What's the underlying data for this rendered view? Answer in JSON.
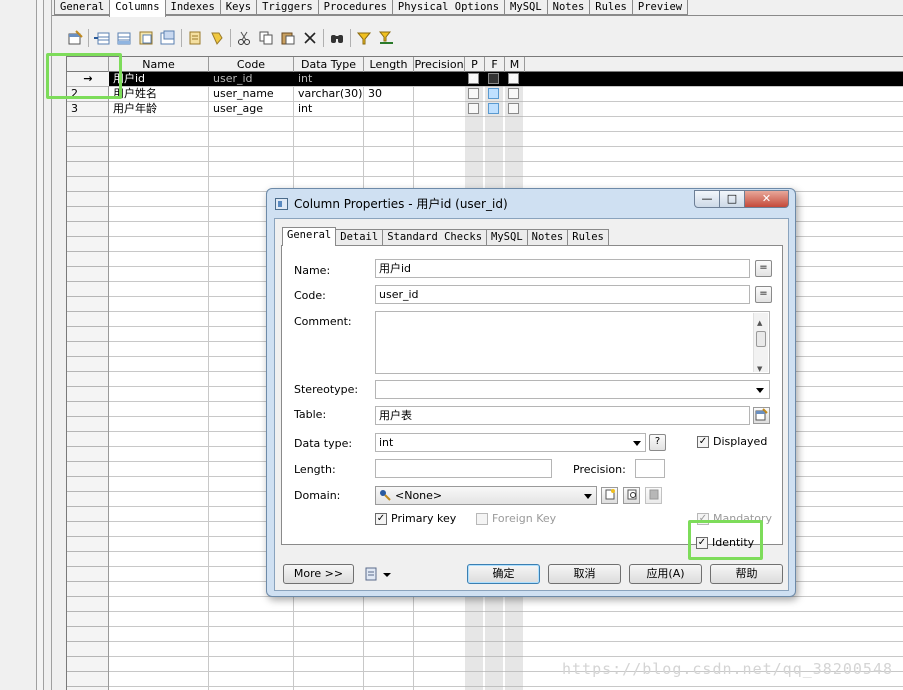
{
  "tabs": [
    "General",
    "Columns",
    "Indexes",
    "Keys",
    "Triggers",
    "Procedures",
    "Physical Options",
    "MySQL",
    "Notes",
    "Rules",
    "Preview"
  ],
  "active_tab": "Columns",
  "toolbar_icons": [
    "properties-icon",
    "insert-row-icon",
    "add-row-icon",
    "insert-from-icon",
    "add-from-icon",
    "copy-to-icon",
    "paste-into-icon",
    "cut-icon",
    "copy-icon",
    "paste-icon",
    "delete-icon",
    "find-icon",
    "filter-icon",
    "clear-filter-icon"
  ],
  "grid": {
    "headers": {
      "name": "Name",
      "code": "Code",
      "data_type": "Data Type",
      "length": "Length",
      "precision": "Precision",
      "p": "P",
      "f": "F",
      "m": "M"
    },
    "rows": [
      {
        "num": "→",
        "name": "用户id",
        "code": "user_id",
        "data_type": "int",
        "length": "",
        "p": true,
        "f": false,
        "m": true,
        "selected": true
      },
      {
        "num": "2",
        "name": "用户姓名",
        "code": "user_name",
        "data_type": "varchar(30)",
        "length": "30",
        "p": false,
        "f": false,
        "m": false,
        "selected": false
      },
      {
        "num": "3",
        "name": "用户年龄",
        "code": "user_age",
        "data_type": "int",
        "length": "",
        "p": false,
        "f": false,
        "m": false,
        "selected": false
      }
    ]
  },
  "dialog": {
    "title": "Column Properties - 用户id (user_id)",
    "window_buttons": {
      "minimize": "—",
      "maximize": "□",
      "close": "✕"
    },
    "tabs": [
      "General",
      "Detail",
      "Standard Checks",
      "MySQL",
      "Notes",
      "Rules"
    ],
    "active_tab": "General",
    "fields": {
      "name_label": "Name:",
      "name_value": "用户id",
      "code_label": "Code:",
      "code_value": "user_id",
      "comment_label": "Comment:",
      "comment_value": "",
      "stereotype_label": "Stereotype:",
      "stereotype_value": "",
      "table_label": "Table:",
      "table_value": "用户表",
      "datatype_label": "Data type:",
      "datatype_value": "int",
      "datatype_help": "?",
      "displayed_label": "Displayed",
      "displayed_checked": true,
      "length_label": "Length:",
      "length_value": "",
      "precision_label": "Precision:",
      "precision_value": "",
      "domain_label": "Domain:",
      "domain_value": "<None>",
      "primary_key_label": "Primary key",
      "primary_key_checked": true,
      "foreign_key_label": "Foreign Key",
      "foreign_key_checked": false,
      "mandatory_label": "Mandatory",
      "mandatory_checked": true,
      "identity_label": "Identity",
      "identity_checked": true,
      "eq_symbol": "="
    },
    "buttons": {
      "more": "More >>",
      "ok": "确定",
      "cancel": "取消",
      "apply": "应用(A)",
      "help": "帮助"
    }
  },
  "watermark": "https://blog.csdn.net/qq_38200548",
  "colors": {
    "highlight": "#7ddc5a",
    "selected_row": "#000000",
    "dialog_frame": "#cfe0f2"
  }
}
